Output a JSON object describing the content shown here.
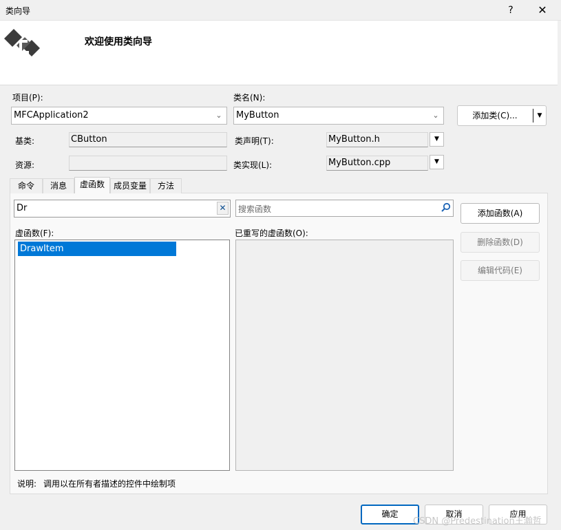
{
  "window": {
    "title": "类向导",
    "help_label": "?",
    "close_label": "✕"
  },
  "header": {
    "welcome": "欢迎使用类向导",
    "logo_icon": "class-wizard-icon"
  },
  "project": {
    "label": "项目(P):",
    "value": "MFCApplication2"
  },
  "classname": {
    "label": "类名(N):",
    "value": "MyButton"
  },
  "add_class_button": "添加类(C)...",
  "base_class": {
    "label": "基类:",
    "value": "CButton"
  },
  "resource": {
    "label": "资源:",
    "value": ""
  },
  "class_decl": {
    "label": "类声明(T):",
    "value": "MyButton.h"
  },
  "class_impl": {
    "label": "类实现(L):",
    "value": "MyButton.cpp"
  },
  "tabs": [
    {
      "label": "命令"
    },
    {
      "label": "消息"
    },
    {
      "label": "虚函数",
      "active": true
    },
    {
      "label": "成员变量"
    },
    {
      "label": "方法"
    }
  ],
  "filter": {
    "value": "Dr",
    "clear_icon": "clear-x-icon"
  },
  "search": {
    "placeholder": "搜索函数",
    "icon": "search-icon"
  },
  "virtual_functions": {
    "label": "虚函数(F):",
    "items": [
      "DrawItem"
    ],
    "selected": "DrawItem"
  },
  "overridden_functions": {
    "label": "已重写的虚函数(O):",
    "items": []
  },
  "buttons": {
    "add_function": "添加函数(A)",
    "delete_function": "删除函数(D)",
    "edit_code": "编辑代码(E)"
  },
  "description": {
    "label": "说明:",
    "text": "调用以在所有者描述的控件中绘制项"
  },
  "footer": {
    "ok": "确定",
    "cancel": "取消",
    "apply": "应用"
  },
  "watermark": "CSDN @Predestination王瀚哲",
  "colors": {
    "selection": "#0078d7",
    "ok_border": "#0067c0"
  }
}
